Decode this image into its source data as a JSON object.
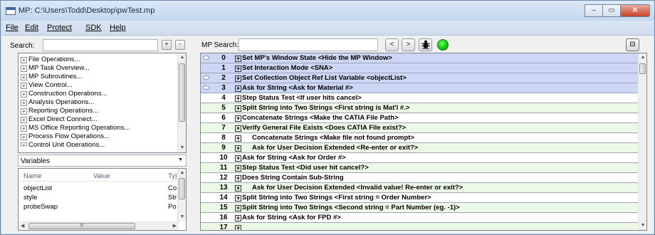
{
  "window": {
    "title": "MP: C:\\Users\\Todd\\Desktop\\pwTest.mp",
    "minimize_label": "‒",
    "maximize_label": "▭",
    "close_label": "✕"
  },
  "menu": [
    "File",
    "Edit",
    "Protect",
    "SDK",
    "Help"
  ],
  "left": {
    "search_label": "Search:",
    "plus_label": "+",
    "minus_label": "-",
    "tree_items": [
      "File Operations...",
      "MP Task Overview...",
      "MP Subroutines...",
      "View Control...",
      "Construction Operations...",
      "Analysis Operations...",
      "Reporting Operations...",
      "Excel Direct Connect...",
      "MS Office Reporting Operations...",
      "Process Flow Operations...",
      "Control Unit Operations..."
    ],
    "combo_value": "Variables",
    "vars_headers": {
      "name": "Name",
      "value": "Value",
      "type": "Ty|"
    },
    "vars_rows": [
      {
        "name": "objectList",
        "value": "",
        "type": "Co"
      },
      {
        "name": "style",
        "value": "",
        "type": "Str"
      },
      {
        "name": "probeSwap",
        "value": "",
        "type": "Po"
      }
    ],
    "hscroll_grip": "III"
  },
  "right": {
    "search_label": "MP Search:",
    "prev_label": "<",
    "next_label": ">",
    "bug_icon": "bug-icon",
    "status_color": "#18c018",
    "pin_label": "⊟",
    "rows": [
      {
        "num": "0",
        "text": "Set MP's Window State  <Hide the MP Window>",
        "indent": 0,
        "bg": "#cdd6f4",
        "bubble": true
      },
      {
        "num": "1",
        "text": "Set Interaction Mode  <SNA>",
        "indent": 0,
        "bg": "#cdd6f4",
        "bubble": false
      },
      {
        "num": "2",
        "text": "Set Collection Object Ref List Variable  <objectList>",
        "indent": 0,
        "bg": "#cdd6f4",
        "bubble": true
      },
      {
        "num": "3",
        "text": "Ask for String  <Ask for Material #>",
        "indent": 0,
        "bg": "#cdd6f4",
        "bubble": true
      },
      {
        "num": "4",
        "text": "Step Status Test  <If user hits cancel>",
        "indent": 0,
        "bg": "#ffffff",
        "bubble": false
      },
      {
        "num": "5",
        "text": "Split String into Two Strings  <First string is Mat'l #.>",
        "indent": 0,
        "bg": "#ecf9e6",
        "bubble": false
      },
      {
        "num": "6",
        "text": "Concatenate Strings  <Make the CATIA File Path>",
        "indent": 0,
        "bg": "#ffffff",
        "bubble": false
      },
      {
        "num": "7",
        "text": "Verify General File Exists  <Does CATIA File exist?>",
        "indent": 0,
        "bg": "#ecf9e6",
        "bubble": false
      },
      {
        "num": "8",
        "text": "Concatenate Strings  <Make file not found prompt>",
        "indent": 1,
        "bg": "#ffffff",
        "bubble": false
      },
      {
        "num": "9",
        "text": "Ask for User Decision Extended  <Re-enter or exit?>",
        "indent": 1,
        "bg": "#ecf9e6",
        "bubble": false
      },
      {
        "num": "10",
        "text": "Ask for String  <Ask for Order #>",
        "indent": 0,
        "bg": "#ffffff",
        "bubble": false
      },
      {
        "num": "11",
        "text": "Step Status Test  <Did user hit cancel?>",
        "indent": 0,
        "bg": "#ecf9e6",
        "bubble": false
      },
      {
        "num": "12",
        "text": "Does String Contain Sub-String",
        "indent": 0,
        "bg": "#ffffff",
        "bubble": false
      },
      {
        "num": "13",
        "text": "Ask for User Decision Extended  <Invalid value! Re-enter or exit?>",
        "indent": 1,
        "bg": "#ecf9e6",
        "bubble": false
      },
      {
        "num": "14",
        "text": "Split String into Two Strings  <First string = Order Number>",
        "indent": 0,
        "bg": "#ffffff",
        "bubble": false
      },
      {
        "num": "15",
        "text": "Split String into Two Strings  <Second string = Part Number (eg. -1)>",
        "indent": 0,
        "bg": "#ecf9e6",
        "bubble": false
      },
      {
        "num": "16",
        "text": "Ask for String  <Ask for FPD #>",
        "indent": 0,
        "bg": "#ffffff",
        "bubble": false
      },
      {
        "num": "17",
        "text": "",
        "indent": 0,
        "bg": "#ecf9e6",
        "bubble": false
      }
    ]
  }
}
